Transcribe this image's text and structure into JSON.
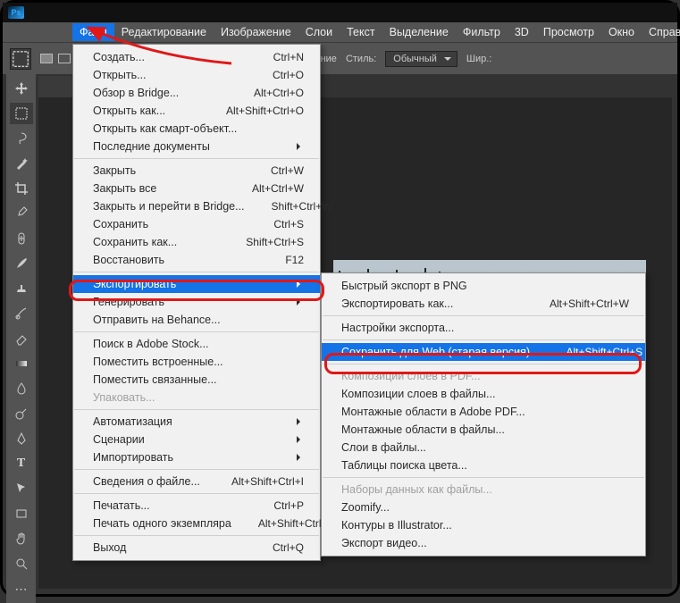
{
  "menubar": {
    "items": [
      "Файл",
      "Редактирование",
      "Изображение",
      "Слои",
      "Текст",
      "Выделение",
      "Фильтр",
      "3D",
      "Просмотр",
      "Окно",
      "Справка"
    ]
  },
  "optionsbar": {
    "smoothing": "Сглаживание",
    "style_label": "Стиль:",
    "style_value": "Обычный",
    "width_label": "Шир.:"
  },
  "file_menu": {
    "create": {
      "label": "Создать...",
      "shortcut": "Ctrl+N"
    },
    "open": {
      "label": "Открыть...",
      "shortcut": "Ctrl+O"
    },
    "browse_bridge": {
      "label": "Обзор в Bridge...",
      "shortcut": "Alt+Ctrl+O"
    },
    "open_as": {
      "label": "Открыть как...",
      "shortcut": "Alt+Shift+Ctrl+O"
    },
    "open_smart": {
      "label": "Открыть как смарт-объект..."
    },
    "recent": {
      "label": "Последние документы"
    },
    "close": {
      "label": "Закрыть",
      "shortcut": "Ctrl+W"
    },
    "close_all": {
      "label": "Закрыть все",
      "shortcut": "Alt+Ctrl+W"
    },
    "close_bridge": {
      "label": "Закрыть и перейти в Bridge...",
      "shortcut": "Shift+Ctrl+W"
    },
    "save": {
      "label": "Сохранить",
      "shortcut": "Ctrl+S"
    },
    "save_as": {
      "label": "Сохранить как...",
      "shortcut": "Shift+Ctrl+S"
    },
    "revert": {
      "label": "Восстановить",
      "shortcut": "F12"
    },
    "export": {
      "label": "Экспортировать"
    },
    "generate": {
      "label": "Генерировать"
    },
    "behance": {
      "label": "Отправить на Behance..."
    },
    "adobe_stock": {
      "label": "Поиск в Adobe Stock..."
    },
    "place_embedded": {
      "label": "Поместить встроенные..."
    },
    "place_linked": {
      "label": "Поместить связанные..."
    },
    "package": {
      "label": "Упаковать..."
    },
    "automate": {
      "label": "Автоматизация"
    },
    "scripts": {
      "label": "Сценарии"
    },
    "import": {
      "label": "Импортировать"
    },
    "file_info": {
      "label": "Сведения о файле...",
      "shortcut": "Alt+Shift+Ctrl+I"
    },
    "print": {
      "label": "Печатать...",
      "shortcut": "Ctrl+P"
    },
    "print_one": {
      "label": "Печать одного экземпляра",
      "shortcut": "Alt+Shift+Ctrl+P"
    },
    "exit": {
      "label": "Выход",
      "shortcut": "Ctrl+Q"
    }
  },
  "export_menu": {
    "quick_png": {
      "label": "Быстрый экспорт в PNG"
    },
    "export_as": {
      "label": "Экспортировать как...",
      "shortcut": "Alt+Shift+Ctrl+W"
    },
    "export_prefs": {
      "label": "Настройки экспорта..."
    },
    "save_for_web": {
      "label": "Сохранить для Web (старая версия)...",
      "shortcut": "Alt+Shift+Ctrl+S"
    },
    "layer_comps_pdf": {
      "label": "Композиции слоев в PDF..."
    },
    "layer_comps_files": {
      "label": "Композиции слоев в файлы..."
    },
    "artboards_pdf": {
      "label": "Монтажные области в Adobe PDF..."
    },
    "artboards_files": {
      "label": "Монтажные области в файлы..."
    },
    "layers_files": {
      "label": "Слои в файлы..."
    },
    "color_lookup": {
      "label": "Таблицы поиска цвета..."
    },
    "datasets": {
      "label": "Наборы данных как файлы..."
    },
    "zoomify": {
      "label": "Zoomify..."
    },
    "paths_illustrator": {
      "label": "Контуры в Illustrator..."
    },
    "export_video": {
      "label": "Экспорт видео..."
    }
  }
}
